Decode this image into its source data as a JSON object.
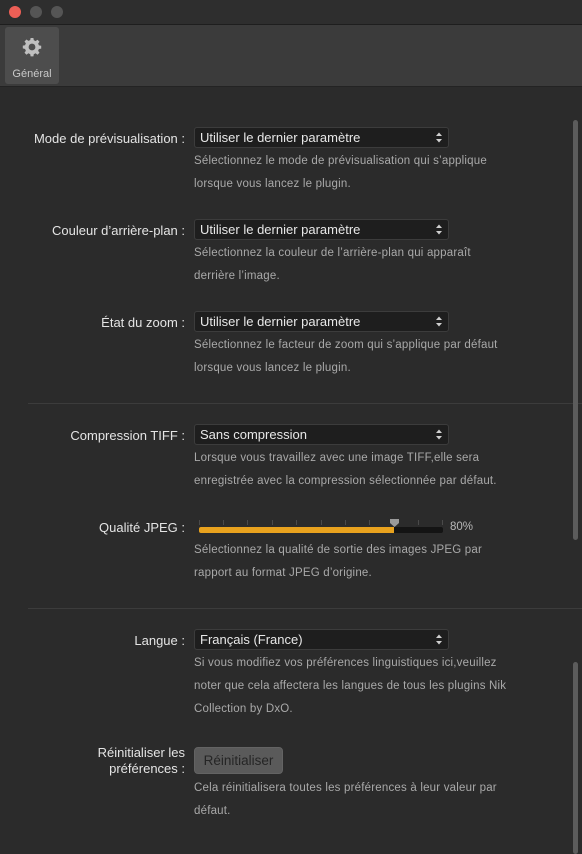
{
  "toolbar": {
    "tabs": [
      {
        "label": "Général",
        "icon": "gear-icon"
      }
    ]
  },
  "colors": {
    "accent": "#e8a21e",
    "close": "#ed5f56"
  },
  "settings": {
    "preview_mode": {
      "label": "Mode de prévisualisation :",
      "value": "Utiliser le dernier paramètre",
      "desc_lines": [
        "Sélectionnez le mode de prévisualisation qui s’applique",
        "lorsque vous lancez le plugin."
      ]
    },
    "background_color": {
      "label": "Couleur d’arrière-plan :",
      "value": "Utiliser le dernier paramètre",
      "desc_lines": [
        "Sélectionnez la couleur de l’arrière-plan qui apparaît",
        "derrière l’image."
      ]
    },
    "zoom_state": {
      "label": "État du zoom :",
      "value": "Utiliser le dernier paramètre",
      "desc_lines": [
        "Sélectionnez le facteur de zoom qui s’applique par défaut",
        "lorsque vous lancez le plugin."
      ]
    },
    "tiff_compression": {
      "label": "Compression TIFF :",
      "value": "Sans compression",
      "desc_lines": [
        "Lorsque vous travaillez avec une image TIFF,elle sera",
        "enregistrée avec la compression sélectionnée par défaut."
      ]
    },
    "jpeg_quality": {
      "label": "Qualité JPEG :",
      "value": 0.8,
      "value_text": "80%",
      "desc_lines": [
        "Sélectionnez la qualité de sortie des images JPEG par",
        "rapport au format JPEG d’origine."
      ]
    },
    "language": {
      "label": "Langue :",
      "value": "Français (France)",
      "desc_lines": [
        "Si vous modifiez vos préférences linguistiques ici,veuillez",
        "noter que cela affectera les langues de tous les plugins Nik",
        "Collection by DxO."
      ]
    },
    "reset": {
      "label_lines": [
        "Réinitialiser les",
        "préférences :"
      ],
      "button_label": "Réinitialiser",
      "desc_lines": [
        "Cela réinitialisera toutes les préférences à leur valeur par",
        "défaut."
      ]
    }
  }
}
